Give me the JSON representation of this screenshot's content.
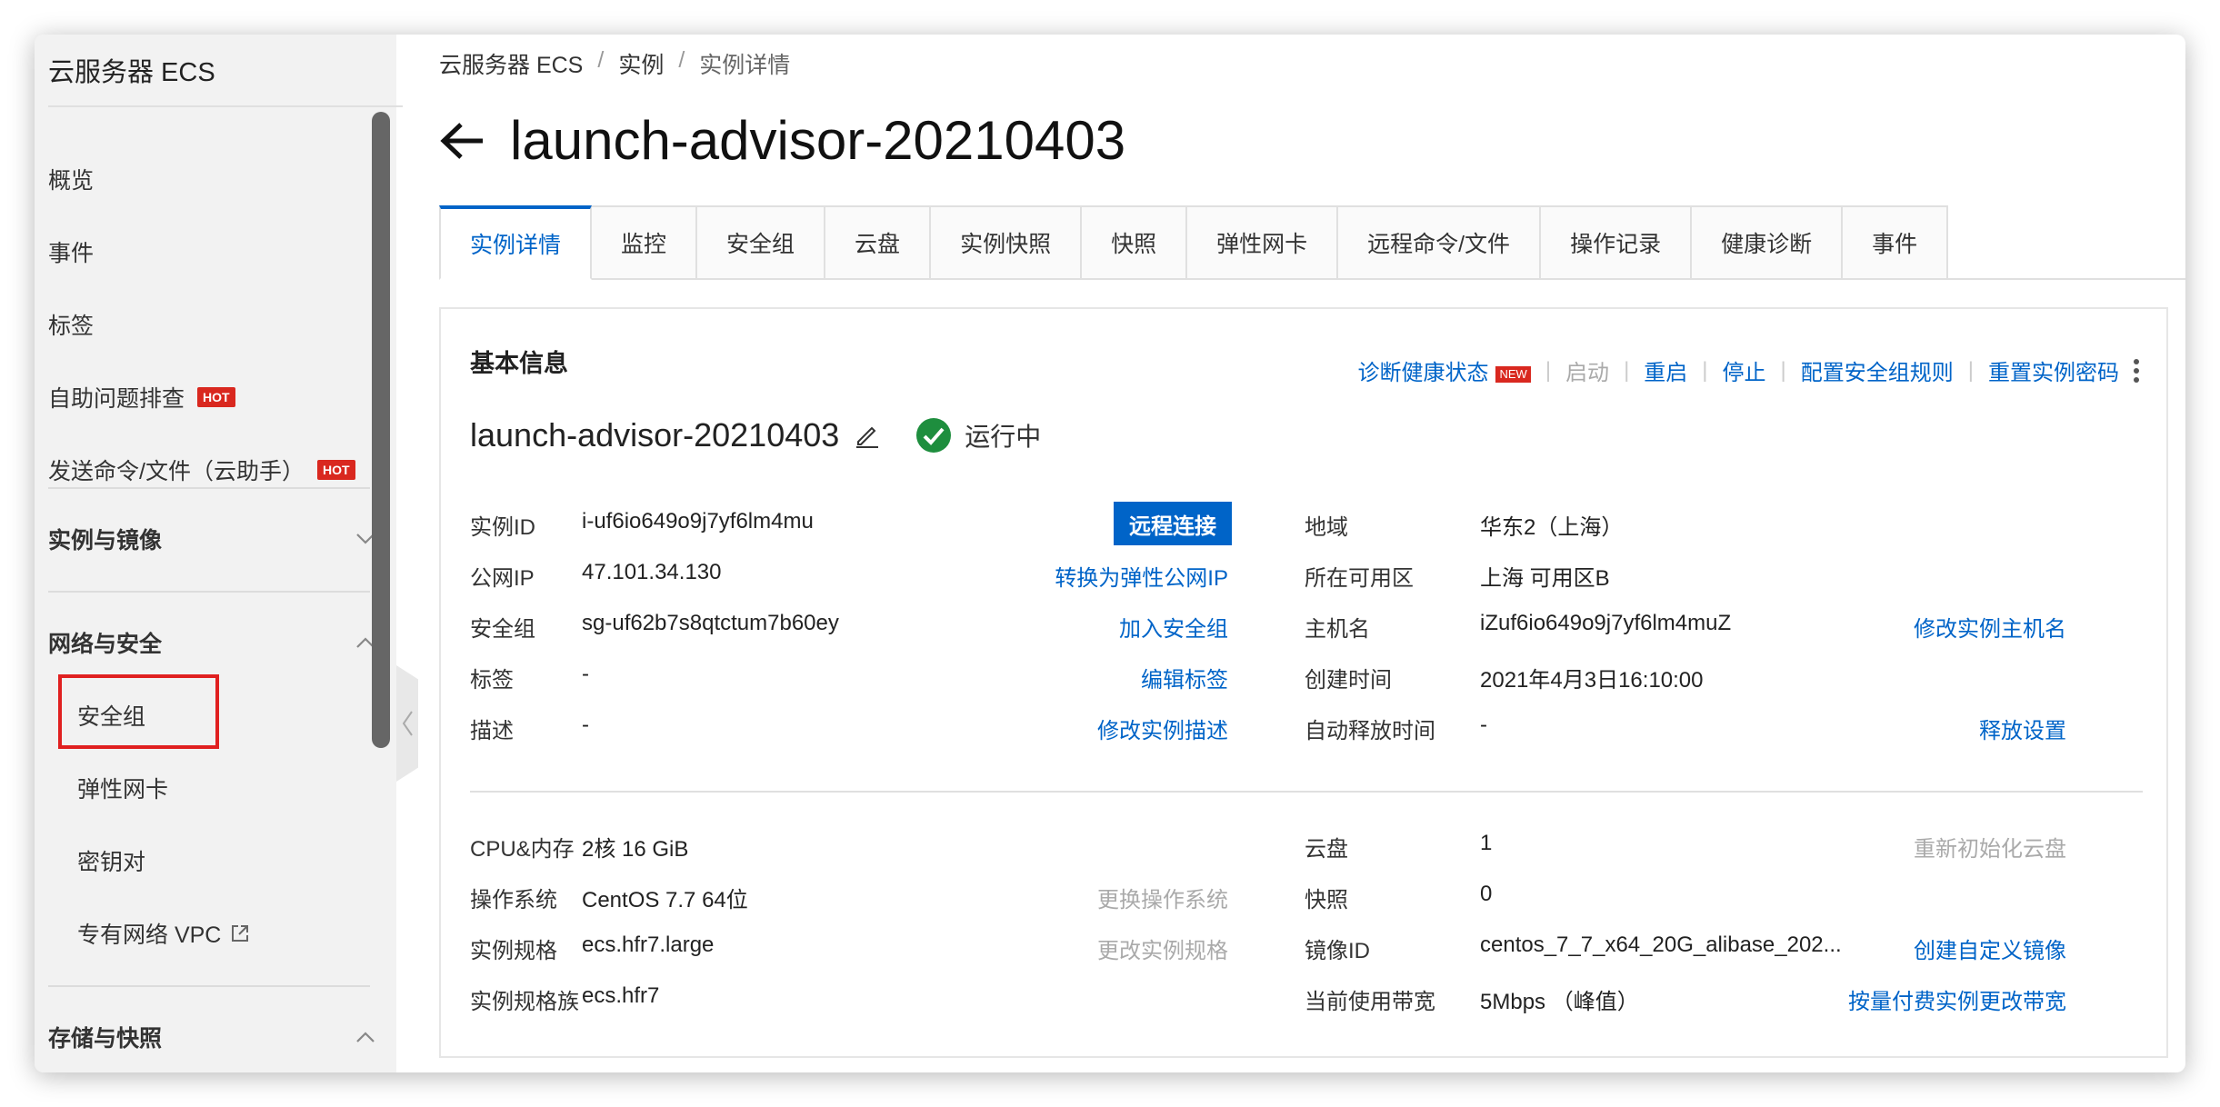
{
  "sidebar": {
    "title": "云服务器 ECS",
    "items": [
      {
        "label": "概览"
      },
      {
        "label": "事件"
      },
      {
        "label": "标签"
      },
      {
        "label": "自助问题排查",
        "badge": "HOT"
      },
      {
        "label": "发送命令/文件（云助手）",
        "badge": "HOT"
      }
    ],
    "groups": [
      {
        "label": "实例与镜像",
        "expanded": false
      },
      {
        "label": "网络与安全",
        "expanded": true
      },
      {
        "label": "存储与快照",
        "expanded": true
      }
    ],
    "network_items": [
      {
        "label": "安全组"
      },
      {
        "label": "弹性网卡"
      },
      {
        "label": "密钥对"
      },
      {
        "label": "专有网络 VPC"
      }
    ]
  },
  "breadcrumb": {
    "items": [
      "云服务器 ECS",
      "实例",
      "实例详情"
    ],
    "separator": "/"
  },
  "page": {
    "title": "launch-advisor-20210403"
  },
  "tabs": [
    {
      "label": "实例详情",
      "active": true
    },
    {
      "label": "监控"
    },
    {
      "label": "安全组"
    },
    {
      "label": "云盘"
    },
    {
      "label": "实例快照"
    },
    {
      "label": "快照"
    },
    {
      "label": "弹性网卡"
    },
    {
      "label": "远程命令/文件"
    },
    {
      "label": "操作记录"
    },
    {
      "label": "健康诊断"
    },
    {
      "label": "事件"
    }
  ],
  "card": {
    "title": "基本信息",
    "actions": {
      "diagnose": "诊断健康状态",
      "new_badge": "NEW",
      "start": "启动",
      "restart": "重启",
      "stop": "停止",
      "config_sg": "配置安全组规则",
      "reset_pwd": "重置实例密码"
    },
    "instance_name": "launch-advisor-20210403",
    "status": "运行中",
    "status_color": "#1e8e3e",
    "left_fields": {
      "id_label": "实例ID",
      "id_value": "i-uf6io649o9j7yf6lm4mu",
      "remote_btn": "远程连接",
      "ip_label": "公网IP",
      "ip_value": "47.101.34.130",
      "ip_action": "转换为弹性公网IP",
      "sg_label": "安全组",
      "sg_value": "sg-uf62b7s8qtctum7b60ey",
      "sg_action": "加入安全组",
      "tag_label": "标签",
      "tag_value": "-",
      "tag_action": "编辑标签",
      "desc_label": "描述",
      "desc_value": "-",
      "desc_action": "修改实例描述"
    },
    "right_fields": {
      "region_label": "地域",
      "region_value": "华东2（上海）",
      "zone_label": "所在可用区",
      "zone_value": "上海 可用区B",
      "host_label": "主机名",
      "host_value": "iZuf6io649o9j7yf6lm4muZ",
      "host_action": "修改实例主机名",
      "created_label": "创建时间",
      "created_value": "2021年4月3日16:10:00",
      "release_label": "自动释放时间",
      "release_value": "-",
      "release_action": "释放设置"
    },
    "spec_left": {
      "cpu_label": "CPU&内存",
      "cpu_value": "2核 16 GiB",
      "os_label": "操作系统",
      "os_value": "CentOS 7.7 64位",
      "os_action": "更换操作系统",
      "type_label": "实例规格",
      "type_value": "ecs.hfr7.large",
      "type_action": "更改实例规格",
      "family_label": "实例规格族",
      "family_value": "ecs.hfr7"
    },
    "spec_right": {
      "disk_label": "云盘",
      "disk_value": "1",
      "disk_action": "重新初始化云盘",
      "snap_label": "快照",
      "snap_value": "0",
      "image_label": "镜像ID",
      "image_value": "centos_7_7_x64_20G_alibase_202...",
      "image_action": "创建自定义镜像",
      "bw_label": "当前使用带宽",
      "bw_value": "5Mbps （峰值）",
      "bw_action": "按量付费实例更改带宽"
    }
  }
}
